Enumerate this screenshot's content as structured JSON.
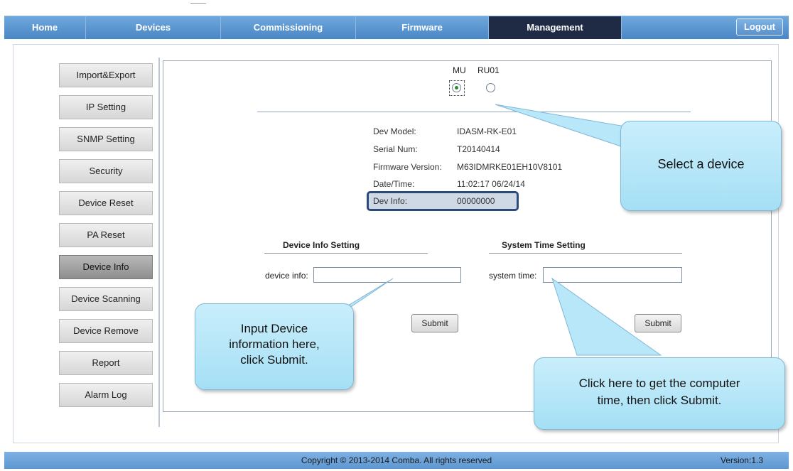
{
  "nav": {
    "tabs": [
      {
        "label": "Home"
      },
      {
        "label": "Devices"
      },
      {
        "label": "Commissioning"
      },
      {
        "label": "Firmware"
      },
      {
        "label": "Management"
      }
    ],
    "logout_label": "Logout",
    "accent_color": "#4a86c5",
    "active_color": "#1f2a44"
  },
  "sidebar": {
    "items": [
      {
        "label": "Import&Export"
      },
      {
        "label": "IP Setting"
      },
      {
        "label": "SNMP Setting"
      },
      {
        "label": "Security"
      },
      {
        "label": "Device Reset"
      },
      {
        "label": "PA Reset"
      },
      {
        "label": "Device Info"
      },
      {
        "label": "Device Scanning"
      },
      {
        "label": "Device Remove"
      },
      {
        "label": "Report"
      },
      {
        "label": "Alarm Log"
      }
    ],
    "active": "Device Info"
  },
  "device_select": {
    "mu_label": "MU",
    "ru_label": "RU01",
    "selected": "MU"
  },
  "info": {
    "model_label": "Dev Model:",
    "model_value": "IDASM-RK-E01",
    "serial_label": "Serial Num:",
    "serial_value": "T20140414",
    "fw_label": "Firmware Version:",
    "fw_value": "M63IDMRKE01EH10V8101",
    "datetime_label": "Date/Time:",
    "datetime_value": "11:02:17 06/24/14",
    "devinfo_label": "Dev Info:",
    "devinfo_value": "00000000"
  },
  "device_info_setting": {
    "title": "Device Info Setting",
    "field_label": "device info:",
    "value": "",
    "submit_label": "Submit"
  },
  "system_time_setting": {
    "title": "System Time Setting",
    "field_label": "system time:",
    "value": "",
    "submit_label": "Submit"
  },
  "callouts": {
    "select_device": "Select a device",
    "input_device_line1": "Input Device",
    "input_device_line2": "information here,",
    "input_device_line3": "click Submit.",
    "click_here_line1": "Click here to get the computer",
    "click_here_line2": "time,  then click Submit."
  },
  "footer": {
    "copyright": "Copyright © 2013-2014 Comba. All rights reserved",
    "version": "Version:1.3"
  }
}
